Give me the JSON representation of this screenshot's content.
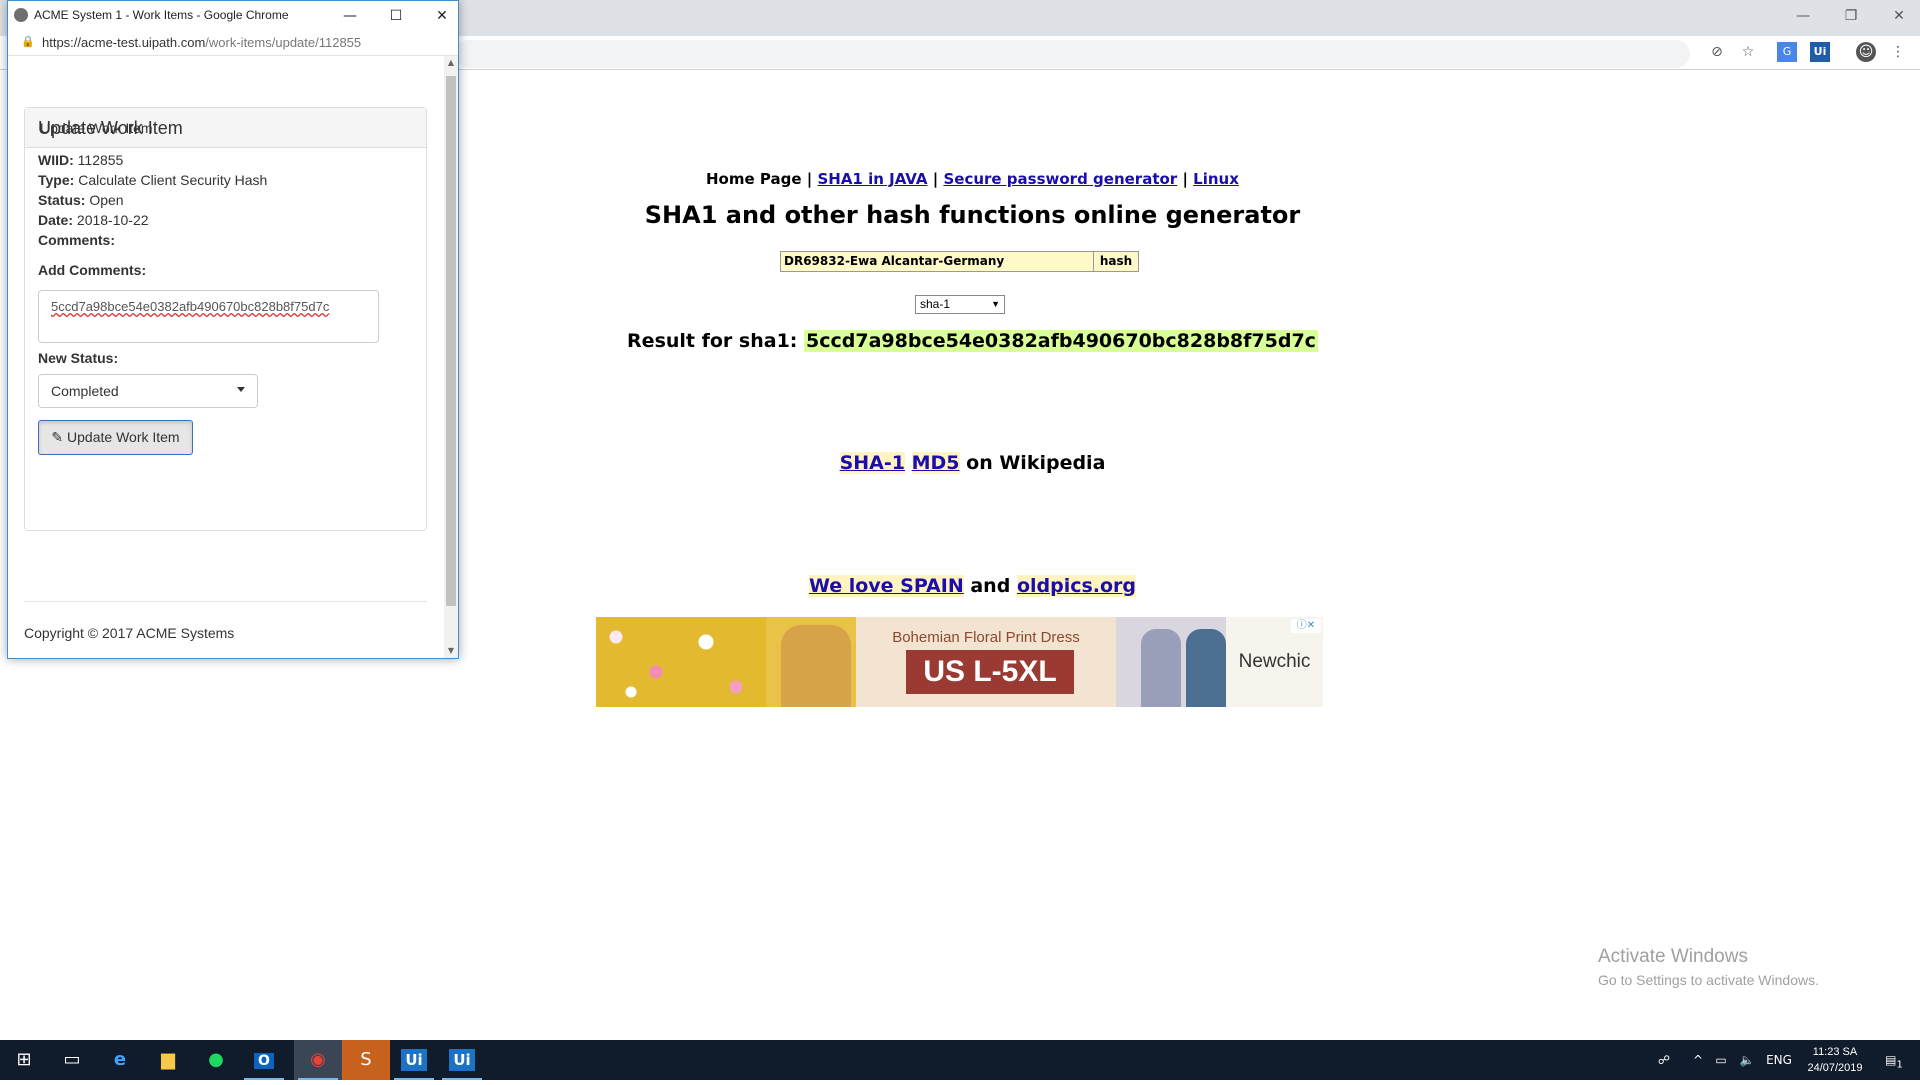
{
  "background_window": {
    "window_controls": {
      "minimize": "—",
      "restore": "❐",
      "close": "✕"
    },
    "nav": {
      "home": "Home Page",
      "sep": "|",
      "links": [
        "SHA1 in JAVA",
        "Secure password generator",
        "Linux"
      ]
    },
    "headline": "SHA1 and other hash functions online generator",
    "hash_input_value": "DR69832-Ewa Alcantar-Germany",
    "hash_button": "hash",
    "algorithm": "sha-1",
    "result_label": "Result for sha1:",
    "result_value": "5ccd7a98bce54e0382afb490670bc828b8f75d7c",
    "wiki": {
      "link1": "SHA-1",
      "link2": "MD5",
      "text": "on Wikipedia"
    },
    "spain": {
      "link1": "We love SPAIN",
      "and": "and",
      "link2": "oldpics.org"
    },
    "ad": {
      "title": "Bohemian Floral Print Dress",
      "size_text": "US L-5XL",
      "brand": "Newchic"
    },
    "activate": {
      "title": "Activate Windows",
      "subtitle": "Go to Settings to activate Windows."
    }
  },
  "popup": {
    "title": "ACME System 1 - Work Items - Google Chrome",
    "url_host": "https://acme-test.uipath.com",
    "url_path": "/work-items/update/112855",
    "panel_heading": "Update Work Item",
    "heading": "Update Work Item",
    "fields": {
      "wiid_label": "WIID:",
      "wiid": "112855",
      "type_label": "Type:",
      "type": "Calculate Client Security Hash",
      "status_label": "Status:",
      "status": "Open",
      "date_label": "Date:",
      "date": "2018-10-22",
      "comments_label": "Comments:"
    },
    "add_comments_label": "Add Comments:",
    "comment_value": "5ccd7a98bce54e0382afb490670bc828b8f75d7c",
    "new_status_label": "New Status:",
    "new_status_value": "Completed",
    "update_button": "Update Work Item",
    "copyright": "Copyright © 2017 ACME Systems"
  },
  "taskbar": {
    "language": "ENG",
    "time": "11:23 SA",
    "date": "24/07/2019",
    "notification_count": "1"
  }
}
